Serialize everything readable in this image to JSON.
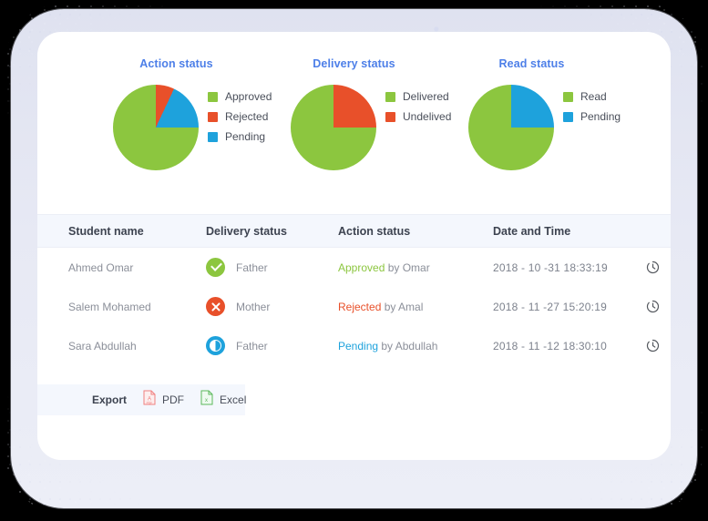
{
  "colors": {
    "green": "#8cc63f",
    "orange": "#e8502a",
    "blue": "#1ea2dc",
    "title_blue": "#4d7fe8",
    "header_bg": "#f4f7fd"
  },
  "chart_data": [
    {
      "type": "pie",
      "title": "Action status",
      "categories": [
        "Approved",
        "Rejected",
        "Pending"
      ],
      "values": [
        75,
        7,
        18
      ],
      "colors": [
        "#8cc63f",
        "#e8502a",
        "#1ea2dc"
      ],
      "legend_position": "right"
    },
    {
      "type": "pie",
      "title": "Delivery status",
      "categories": [
        "Delivered",
        "Undelived"
      ],
      "values": [
        75,
        25
      ],
      "colors": [
        "#8cc63f",
        "#e8502a"
      ],
      "legend_position": "right"
    },
    {
      "type": "pie",
      "title": "Read status",
      "categories": [
        "Read",
        "Pending"
      ],
      "values": [
        75,
        25
      ],
      "colors": [
        "#8cc63f",
        "#1ea2dc"
      ],
      "legend_position": "right"
    }
  ],
  "table": {
    "headers": [
      "Student name",
      "Delivery status",
      "Action status",
      "Date and Time"
    ],
    "rows": [
      {
        "student_name": "Ahmed Omar",
        "delivery_icon": "check-circle-icon",
        "delivery_text": "Father",
        "action_state": "Approved",
        "action_by": " by Omar",
        "action_kind": "approved",
        "date": "2018 - 10 -31  18:33:19",
        "history_icon": "history-clock-icon"
      },
      {
        "student_name": "Salem Mohamed",
        "delivery_icon": "x-circle-icon",
        "delivery_text": "Mother",
        "action_state": "Rejected",
        "action_by": " by Amal",
        "action_kind": "rejected",
        "date": "2018 - 11 -27  15:20:19",
        "history_icon": "history-clock-icon"
      },
      {
        "student_name": "Sara Abdullah",
        "delivery_icon": "half-circle-icon",
        "delivery_text": "Father",
        "action_state": "Pending",
        "action_by": " by Abdullah",
        "action_kind": "pending",
        "date": "2018 - 11 -12  18:30:10",
        "history_icon": "history-clock-icon"
      }
    ]
  },
  "export": {
    "label": "Export",
    "buttons": [
      {
        "label": "PDF",
        "icon": "pdf-file-icon",
        "color": "#f08080"
      },
      {
        "label": "Excel",
        "icon": "excel-file-icon",
        "color": "#5cb85c"
      }
    ]
  }
}
